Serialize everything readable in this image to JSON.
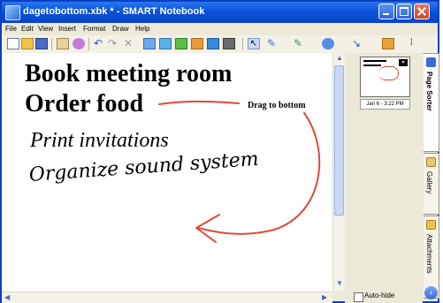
{
  "window": {
    "title": "dagetobottom.xbk * - SMART Notebook"
  },
  "menu": [
    "File",
    "Edit",
    "View",
    "Insert",
    "Format",
    "Draw",
    "Help"
  ],
  "toolbar": {
    "icons": [
      "new-page-icon",
      "open-icon",
      "save-icon",
      "paste-icon",
      "pin-icon",
      "undo-icon",
      "redo-icon",
      "delete-icon",
      "screen-icon",
      "capture-icon",
      "insert-icon",
      "table-icon",
      "presentation-icon",
      "camera-icon",
      "select-icon",
      "pen-icon",
      "highlighter-icon",
      "shape-icon",
      "line-icon",
      "fill-icon"
    ]
  },
  "canvas": {
    "line1": "Book meeting room",
    "line2": "Order food",
    "line3": "Print invitations",
    "line4": "Organize sound system",
    "annotation": "Drag to bottom"
  },
  "sidebar": {
    "thumbnail_label": "Jan 6 - 3:22 PM",
    "autohide": "Auto-hide"
  },
  "tabs": {
    "sorter": "Page Sorter",
    "gallery": "Gallery",
    "attachments": "Attachments"
  },
  "colors": {
    "titlebar": "#0a52d8",
    "ink": "#e04a38",
    "text": "#000000"
  }
}
